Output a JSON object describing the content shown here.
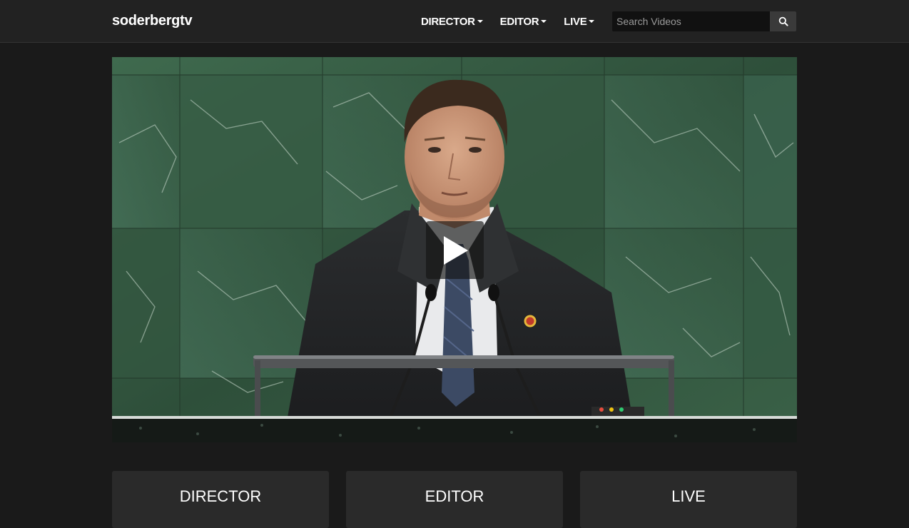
{
  "brand": "soderbergtv",
  "nav": {
    "items": [
      {
        "label": "DIRECTOR"
      },
      {
        "label": "EDITOR"
      },
      {
        "label": "LIVE"
      }
    ]
  },
  "search": {
    "placeholder": "Search Videos",
    "icon": "search-icon"
  },
  "video": {
    "play_icon": "play-icon"
  },
  "cards": [
    {
      "label": "DIRECTOR"
    },
    {
      "label": "EDITOR"
    },
    {
      "label": "LIVE"
    }
  ],
  "colors": {
    "navbar": "#222222",
    "background": "#1a1a1a",
    "card": "#2a2a2a",
    "marble": "#2f4a38"
  }
}
